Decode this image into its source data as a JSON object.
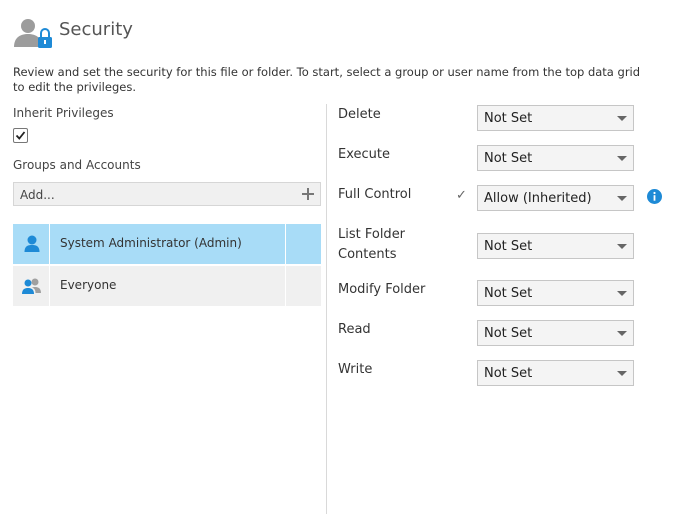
{
  "header": {
    "title": "Security",
    "icon": "user-lock-icon"
  },
  "description": "Review and set the security for this file or folder. To start, select a group or user name from the top data grid to edit the privileges.",
  "inherit": {
    "label": "Inherit Privileges",
    "checked": true
  },
  "groups": {
    "label": "Groups and Accounts",
    "add_placeholder": "Add...",
    "rows": [
      {
        "name": "System Administrator (Admin)",
        "icon": "user-icon",
        "selected": true
      },
      {
        "name": "Everyone",
        "icon": "group-icon",
        "selected": false
      }
    ]
  },
  "permissions": [
    {
      "label": "Delete",
      "value": "Not Set"
    },
    {
      "label": "Execute",
      "value": "Not Set"
    },
    {
      "label": "Full Control",
      "value": "Allow (Inherited)",
      "inherited_mark": "✓",
      "info": true
    },
    {
      "label": "List Folder Contents",
      "value": "Not Set"
    },
    {
      "label": "Modify Folder",
      "value": "Not Set"
    },
    {
      "label": "Read",
      "value": "Not Set"
    },
    {
      "label": "Write",
      "value": "Not Set"
    }
  ],
  "colors": {
    "selected_row": "#a8dcf7",
    "info_blue": "#1e8ad6",
    "lock_blue": "#1e8ad6"
  }
}
